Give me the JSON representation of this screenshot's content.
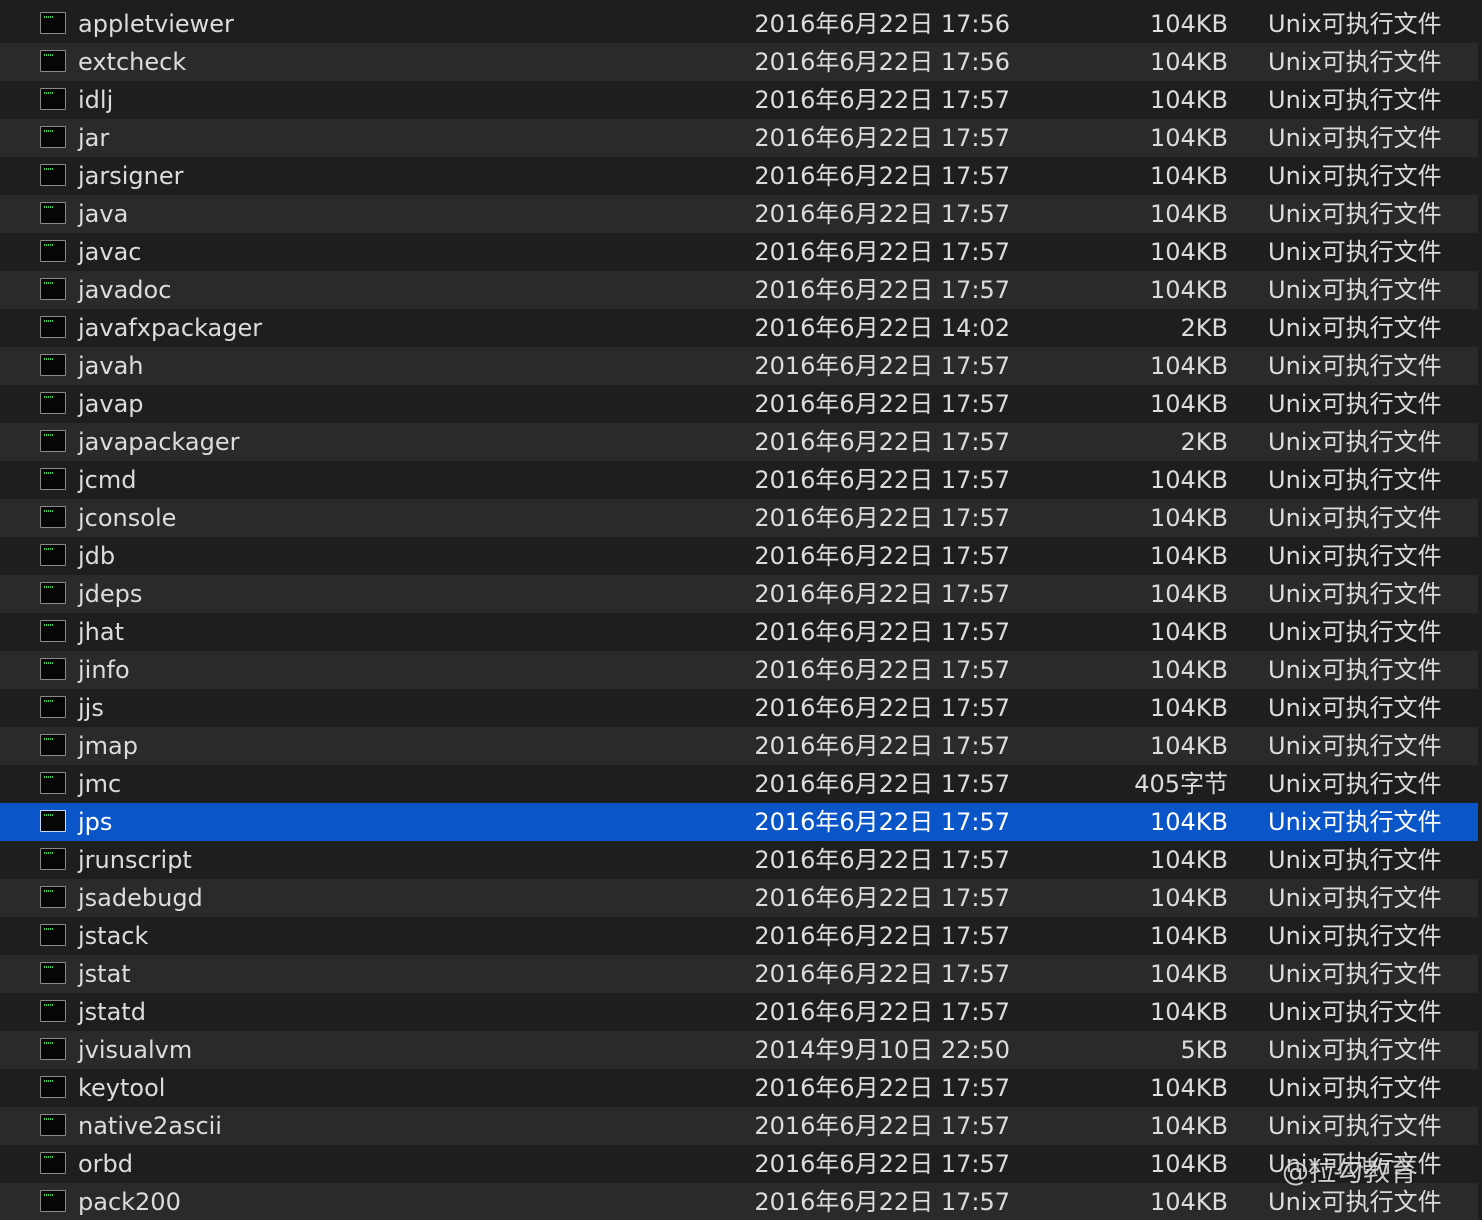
{
  "files": [
    {
      "name": "appletviewer",
      "date": "2016年6月22日 17:56",
      "size": "104KB",
      "kind": "Unix可执行文件"
    },
    {
      "name": "extcheck",
      "date": "2016年6月22日 17:56",
      "size": "104KB",
      "kind": "Unix可执行文件"
    },
    {
      "name": "idlj",
      "date": "2016年6月22日 17:57",
      "size": "104KB",
      "kind": "Unix可执行文件"
    },
    {
      "name": "jar",
      "date": "2016年6月22日 17:57",
      "size": "104KB",
      "kind": "Unix可执行文件"
    },
    {
      "name": "jarsigner",
      "date": "2016年6月22日 17:57",
      "size": "104KB",
      "kind": "Unix可执行文件"
    },
    {
      "name": "java",
      "date": "2016年6月22日 17:57",
      "size": "104KB",
      "kind": "Unix可执行文件"
    },
    {
      "name": "javac",
      "date": "2016年6月22日 17:57",
      "size": "104KB",
      "kind": "Unix可执行文件"
    },
    {
      "name": "javadoc",
      "date": "2016年6月22日 17:57",
      "size": "104KB",
      "kind": "Unix可执行文件"
    },
    {
      "name": "javafxpackager",
      "date": "2016年6月22日 14:02",
      "size": "2KB",
      "kind": "Unix可执行文件"
    },
    {
      "name": "javah",
      "date": "2016年6月22日 17:57",
      "size": "104KB",
      "kind": "Unix可执行文件"
    },
    {
      "name": "javap",
      "date": "2016年6月22日 17:57",
      "size": "104KB",
      "kind": "Unix可执行文件"
    },
    {
      "name": "javapackager",
      "date": "2016年6月22日 17:57",
      "size": "2KB",
      "kind": "Unix可执行文件"
    },
    {
      "name": "jcmd",
      "date": "2016年6月22日 17:57",
      "size": "104KB",
      "kind": "Unix可执行文件"
    },
    {
      "name": "jconsole",
      "date": "2016年6月22日 17:57",
      "size": "104KB",
      "kind": "Unix可执行文件"
    },
    {
      "name": "jdb",
      "date": "2016年6月22日 17:57",
      "size": "104KB",
      "kind": "Unix可执行文件"
    },
    {
      "name": "jdeps",
      "date": "2016年6月22日 17:57",
      "size": "104KB",
      "kind": "Unix可执行文件"
    },
    {
      "name": "jhat",
      "date": "2016年6月22日 17:57",
      "size": "104KB",
      "kind": "Unix可执行文件"
    },
    {
      "name": "jinfo",
      "date": "2016年6月22日 17:57",
      "size": "104KB",
      "kind": "Unix可执行文件"
    },
    {
      "name": "jjs",
      "date": "2016年6月22日 17:57",
      "size": "104KB",
      "kind": "Unix可执行文件"
    },
    {
      "name": "jmap",
      "date": "2016年6月22日 17:57",
      "size": "104KB",
      "kind": "Unix可执行文件"
    },
    {
      "name": "jmc",
      "date": "2016年6月22日 17:57",
      "size": "405字节",
      "kind": "Unix可执行文件"
    },
    {
      "name": "jps",
      "date": "2016年6月22日 17:57",
      "size": "104KB",
      "kind": "Unix可执行文件",
      "selected": true
    },
    {
      "name": "jrunscript",
      "date": "2016年6月22日 17:57",
      "size": "104KB",
      "kind": "Unix可执行文件"
    },
    {
      "name": "jsadebugd",
      "date": "2016年6月22日 17:57",
      "size": "104KB",
      "kind": "Unix可执行文件"
    },
    {
      "name": "jstack",
      "date": "2016年6月22日 17:57",
      "size": "104KB",
      "kind": "Unix可执行文件"
    },
    {
      "name": "jstat",
      "date": "2016年6月22日 17:57",
      "size": "104KB",
      "kind": "Unix可执行文件"
    },
    {
      "name": "jstatd",
      "date": "2016年6月22日 17:57",
      "size": "104KB",
      "kind": "Unix可执行文件"
    },
    {
      "name": "jvisualvm",
      "date": "2014年9月10日 22:50",
      "size": "5KB",
      "kind": "Unix可执行文件"
    },
    {
      "name": "keytool",
      "date": "2016年6月22日 17:57",
      "size": "104KB",
      "kind": "Unix可执行文件"
    },
    {
      "name": "native2ascii",
      "date": "2016年6月22日 17:57",
      "size": "104KB",
      "kind": "Unix可执行文件"
    },
    {
      "name": "orbd",
      "date": "2016年6月22日 17:57",
      "size": "104KB",
      "kind": "Unix可执行文件"
    },
    {
      "name": "pack200",
      "date": "2016年6月22日 17:57",
      "size": "104KB",
      "kind": "Unix可执行文件"
    }
  ],
  "icon": "terminal-executable-icon",
  "colors": {
    "background": "#1e1e1e",
    "alt_row": "#2a2a2a",
    "selection": "#0a56c9",
    "text": "#dcdcdc"
  },
  "watermark": "@拉勾教育"
}
